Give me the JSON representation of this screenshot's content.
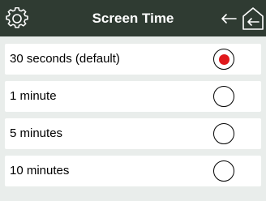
{
  "header": {
    "title": "Screen Time",
    "left_icon": "settings-gear-icon",
    "back_icon": "back-arrow-icon",
    "home_icon": "home-back-icon",
    "background": "#2f3b32"
  },
  "options": [
    {
      "label": "30 seconds (default)",
      "selected": true
    },
    {
      "label": "1 minute",
      "selected": false
    },
    {
      "label": "5 minutes",
      "selected": false
    },
    {
      "label": "10 minutes",
      "selected": false
    }
  ],
  "colors": {
    "accent": "#e0191c",
    "row_background": "#ffffff",
    "page_background": "#e9edeb"
  }
}
